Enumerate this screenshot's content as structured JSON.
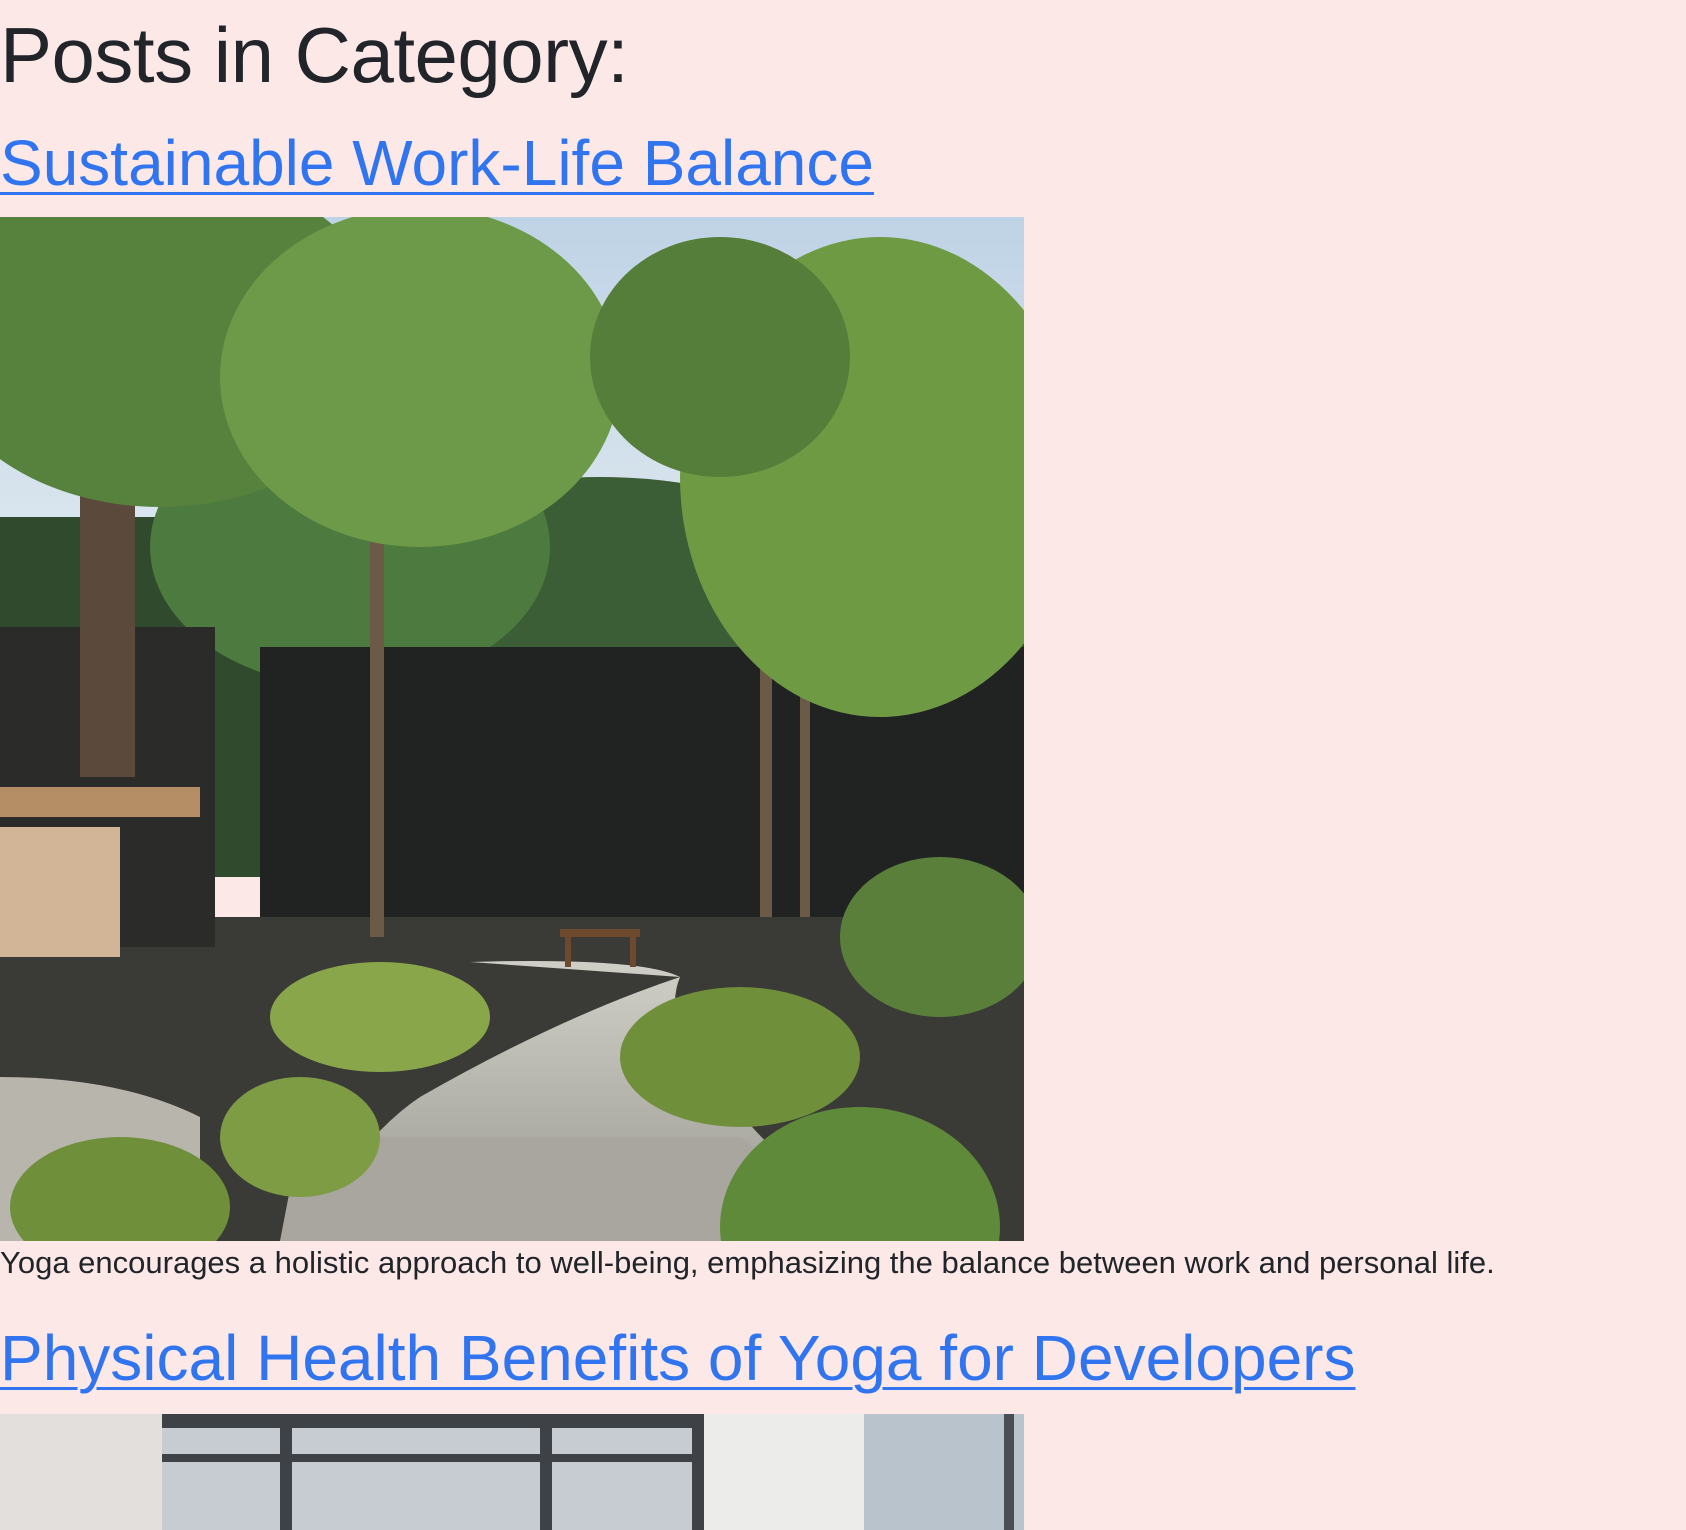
{
  "page": {
    "heading": "Posts in Category:"
  },
  "posts": [
    {
      "title": "Sustainable Work-Life Balance",
      "image_description": "path-through-forest-garden",
      "excerpt": "Yoga encourages a holistic approach to well-being, emphasizing the balance between work and personal life."
    },
    {
      "title": "Physical Health Benefits of Yoga for Developers",
      "image_description": "office-window-interior"
    }
  ],
  "colors": {
    "background": "#fde8e8",
    "link": "#3075ef",
    "text": "#212529"
  }
}
